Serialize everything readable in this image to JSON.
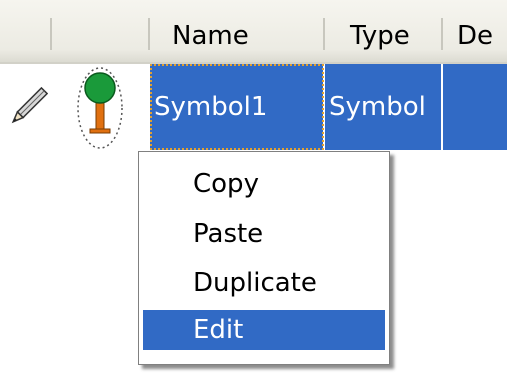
{
  "grid": {
    "columns": [
      {
        "label": ""
      },
      {
        "label": ""
      },
      {
        "label": "Name"
      },
      {
        "label": "Type"
      },
      {
        "label": "De"
      }
    ],
    "row": {
      "name": "Symbol1",
      "type": "Symbol"
    }
  },
  "context_menu": {
    "items": [
      {
        "label": "Copy"
      },
      {
        "label": "Paste"
      },
      {
        "label": "Duplicate"
      },
      {
        "label": "Edit"
      }
    ],
    "highlighted": "Edit"
  },
  "colors": {
    "selection": "#316ac5",
    "focus_border": "#e0a030",
    "header_bg": "#ecebe3"
  },
  "icons": [
    "pencil-icon",
    "tree-symbol-icon"
  ]
}
